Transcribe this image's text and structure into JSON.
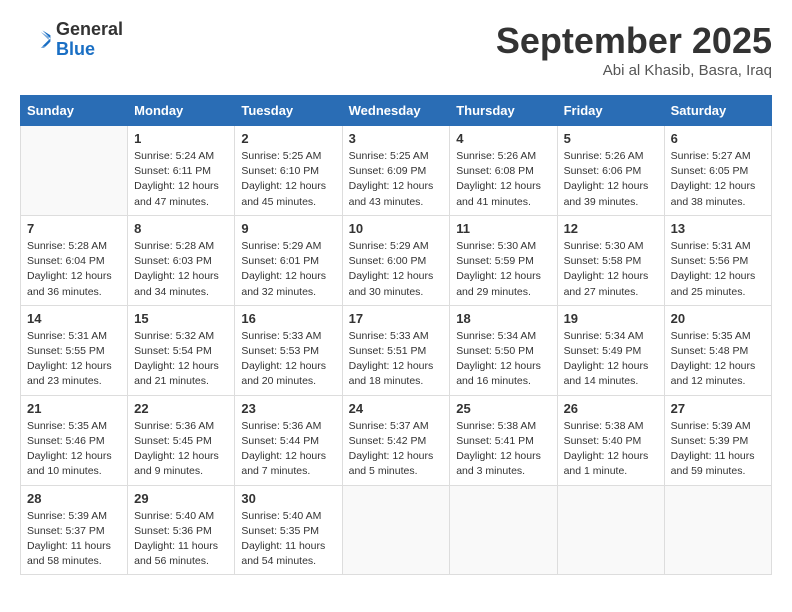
{
  "header": {
    "logo_general": "General",
    "logo_blue": "Blue",
    "month_title": "September 2025",
    "location": "Abi al Khasib, Basra, Iraq"
  },
  "weekdays": [
    "Sunday",
    "Monday",
    "Tuesday",
    "Wednesday",
    "Thursday",
    "Friday",
    "Saturday"
  ],
  "weeks": [
    [
      {
        "day": "",
        "info": ""
      },
      {
        "day": "1",
        "info": "Sunrise: 5:24 AM\nSunset: 6:11 PM\nDaylight: 12 hours\nand 47 minutes."
      },
      {
        "day": "2",
        "info": "Sunrise: 5:25 AM\nSunset: 6:10 PM\nDaylight: 12 hours\nand 45 minutes."
      },
      {
        "day": "3",
        "info": "Sunrise: 5:25 AM\nSunset: 6:09 PM\nDaylight: 12 hours\nand 43 minutes."
      },
      {
        "day": "4",
        "info": "Sunrise: 5:26 AM\nSunset: 6:08 PM\nDaylight: 12 hours\nand 41 minutes."
      },
      {
        "day": "5",
        "info": "Sunrise: 5:26 AM\nSunset: 6:06 PM\nDaylight: 12 hours\nand 39 minutes."
      },
      {
        "day": "6",
        "info": "Sunrise: 5:27 AM\nSunset: 6:05 PM\nDaylight: 12 hours\nand 38 minutes."
      }
    ],
    [
      {
        "day": "7",
        "info": "Sunrise: 5:28 AM\nSunset: 6:04 PM\nDaylight: 12 hours\nand 36 minutes."
      },
      {
        "day": "8",
        "info": "Sunrise: 5:28 AM\nSunset: 6:03 PM\nDaylight: 12 hours\nand 34 minutes."
      },
      {
        "day": "9",
        "info": "Sunrise: 5:29 AM\nSunset: 6:01 PM\nDaylight: 12 hours\nand 32 minutes."
      },
      {
        "day": "10",
        "info": "Sunrise: 5:29 AM\nSunset: 6:00 PM\nDaylight: 12 hours\nand 30 minutes."
      },
      {
        "day": "11",
        "info": "Sunrise: 5:30 AM\nSunset: 5:59 PM\nDaylight: 12 hours\nand 29 minutes."
      },
      {
        "day": "12",
        "info": "Sunrise: 5:30 AM\nSunset: 5:58 PM\nDaylight: 12 hours\nand 27 minutes."
      },
      {
        "day": "13",
        "info": "Sunrise: 5:31 AM\nSunset: 5:56 PM\nDaylight: 12 hours\nand 25 minutes."
      }
    ],
    [
      {
        "day": "14",
        "info": "Sunrise: 5:31 AM\nSunset: 5:55 PM\nDaylight: 12 hours\nand 23 minutes."
      },
      {
        "day": "15",
        "info": "Sunrise: 5:32 AM\nSunset: 5:54 PM\nDaylight: 12 hours\nand 21 minutes."
      },
      {
        "day": "16",
        "info": "Sunrise: 5:33 AM\nSunset: 5:53 PM\nDaylight: 12 hours\nand 20 minutes."
      },
      {
        "day": "17",
        "info": "Sunrise: 5:33 AM\nSunset: 5:51 PM\nDaylight: 12 hours\nand 18 minutes."
      },
      {
        "day": "18",
        "info": "Sunrise: 5:34 AM\nSunset: 5:50 PM\nDaylight: 12 hours\nand 16 minutes."
      },
      {
        "day": "19",
        "info": "Sunrise: 5:34 AM\nSunset: 5:49 PM\nDaylight: 12 hours\nand 14 minutes."
      },
      {
        "day": "20",
        "info": "Sunrise: 5:35 AM\nSunset: 5:48 PM\nDaylight: 12 hours\nand 12 minutes."
      }
    ],
    [
      {
        "day": "21",
        "info": "Sunrise: 5:35 AM\nSunset: 5:46 PM\nDaylight: 12 hours\nand 10 minutes."
      },
      {
        "day": "22",
        "info": "Sunrise: 5:36 AM\nSunset: 5:45 PM\nDaylight: 12 hours\nand 9 minutes."
      },
      {
        "day": "23",
        "info": "Sunrise: 5:36 AM\nSunset: 5:44 PM\nDaylight: 12 hours\nand 7 minutes."
      },
      {
        "day": "24",
        "info": "Sunrise: 5:37 AM\nSunset: 5:42 PM\nDaylight: 12 hours\nand 5 minutes."
      },
      {
        "day": "25",
        "info": "Sunrise: 5:38 AM\nSunset: 5:41 PM\nDaylight: 12 hours\nand 3 minutes."
      },
      {
        "day": "26",
        "info": "Sunrise: 5:38 AM\nSunset: 5:40 PM\nDaylight: 12 hours\nand 1 minute."
      },
      {
        "day": "27",
        "info": "Sunrise: 5:39 AM\nSunset: 5:39 PM\nDaylight: 11 hours\nand 59 minutes."
      }
    ],
    [
      {
        "day": "28",
        "info": "Sunrise: 5:39 AM\nSunset: 5:37 PM\nDaylight: 11 hours\nand 58 minutes."
      },
      {
        "day": "29",
        "info": "Sunrise: 5:40 AM\nSunset: 5:36 PM\nDaylight: 11 hours\nand 56 minutes."
      },
      {
        "day": "30",
        "info": "Sunrise: 5:40 AM\nSunset: 5:35 PM\nDaylight: 11 hours\nand 54 minutes."
      },
      {
        "day": "",
        "info": ""
      },
      {
        "day": "",
        "info": ""
      },
      {
        "day": "",
        "info": ""
      },
      {
        "day": "",
        "info": ""
      }
    ]
  ]
}
